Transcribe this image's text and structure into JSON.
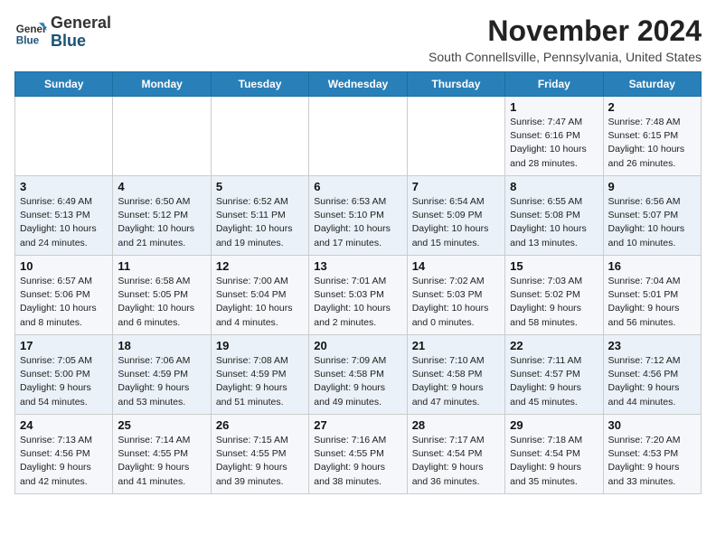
{
  "logo": {
    "general": "General",
    "blue": "Blue"
  },
  "header": {
    "month": "November 2024",
    "location": "South Connellsville, Pennsylvania, United States"
  },
  "weekdays": [
    "Sunday",
    "Monday",
    "Tuesday",
    "Wednesday",
    "Thursday",
    "Friday",
    "Saturday"
  ],
  "weeks": [
    [
      {
        "day": "",
        "info": ""
      },
      {
        "day": "",
        "info": ""
      },
      {
        "day": "",
        "info": ""
      },
      {
        "day": "",
        "info": ""
      },
      {
        "day": "",
        "info": ""
      },
      {
        "day": "1",
        "info": "Sunrise: 7:47 AM\nSunset: 6:16 PM\nDaylight: 10 hours and 28 minutes."
      },
      {
        "day": "2",
        "info": "Sunrise: 7:48 AM\nSunset: 6:15 PM\nDaylight: 10 hours and 26 minutes."
      }
    ],
    [
      {
        "day": "3",
        "info": "Sunrise: 6:49 AM\nSunset: 5:13 PM\nDaylight: 10 hours and 24 minutes."
      },
      {
        "day": "4",
        "info": "Sunrise: 6:50 AM\nSunset: 5:12 PM\nDaylight: 10 hours and 21 minutes."
      },
      {
        "day": "5",
        "info": "Sunrise: 6:52 AM\nSunset: 5:11 PM\nDaylight: 10 hours and 19 minutes."
      },
      {
        "day": "6",
        "info": "Sunrise: 6:53 AM\nSunset: 5:10 PM\nDaylight: 10 hours and 17 minutes."
      },
      {
        "day": "7",
        "info": "Sunrise: 6:54 AM\nSunset: 5:09 PM\nDaylight: 10 hours and 15 minutes."
      },
      {
        "day": "8",
        "info": "Sunrise: 6:55 AM\nSunset: 5:08 PM\nDaylight: 10 hours and 13 minutes."
      },
      {
        "day": "9",
        "info": "Sunrise: 6:56 AM\nSunset: 5:07 PM\nDaylight: 10 hours and 10 minutes."
      }
    ],
    [
      {
        "day": "10",
        "info": "Sunrise: 6:57 AM\nSunset: 5:06 PM\nDaylight: 10 hours and 8 minutes."
      },
      {
        "day": "11",
        "info": "Sunrise: 6:58 AM\nSunset: 5:05 PM\nDaylight: 10 hours and 6 minutes."
      },
      {
        "day": "12",
        "info": "Sunrise: 7:00 AM\nSunset: 5:04 PM\nDaylight: 10 hours and 4 minutes."
      },
      {
        "day": "13",
        "info": "Sunrise: 7:01 AM\nSunset: 5:03 PM\nDaylight: 10 hours and 2 minutes."
      },
      {
        "day": "14",
        "info": "Sunrise: 7:02 AM\nSunset: 5:03 PM\nDaylight: 10 hours and 0 minutes."
      },
      {
        "day": "15",
        "info": "Sunrise: 7:03 AM\nSunset: 5:02 PM\nDaylight: 9 hours and 58 minutes."
      },
      {
        "day": "16",
        "info": "Sunrise: 7:04 AM\nSunset: 5:01 PM\nDaylight: 9 hours and 56 minutes."
      }
    ],
    [
      {
        "day": "17",
        "info": "Sunrise: 7:05 AM\nSunset: 5:00 PM\nDaylight: 9 hours and 54 minutes."
      },
      {
        "day": "18",
        "info": "Sunrise: 7:06 AM\nSunset: 4:59 PM\nDaylight: 9 hours and 53 minutes."
      },
      {
        "day": "19",
        "info": "Sunrise: 7:08 AM\nSunset: 4:59 PM\nDaylight: 9 hours and 51 minutes."
      },
      {
        "day": "20",
        "info": "Sunrise: 7:09 AM\nSunset: 4:58 PM\nDaylight: 9 hours and 49 minutes."
      },
      {
        "day": "21",
        "info": "Sunrise: 7:10 AM\nSunset: 4:58 PM\nDaylight: 9 hours and 47 minutes."
      },
      {
        "day": "22",
        "info": "Sunrise: 7:11 AM\nSunset: 4:57 PM\nDaylight: 9 hours and 45 minutes."
      },
      {
        "day": "23",
        "info": "Sunrise: 7:12 AM\nSunset: 4:56 PM\nDaylight: 9 hours and 44 minutes."
      }
    ],
    [
      {
        "day": "24",
        "info": "Sunrise: 7:13 AM\nSunset: 4:56 PM\nDaylight: 9 hours and 42 minutes."
      },
      {
        "day": "25",
        "info": "Sunrise: 7:14 AM\nSunset: 4:55 PM\nDaylight: 9 hours and 41 minutes."
      },
      {
        "day": "26",
        "info": "Sunrise: 7:15 AM\nSunset: 4:55 PM\nDaylight: 9 hours and 39 minutes."
      },
      {
        "day": "27",
        "info": "Sunrise: 7:16 AM\nSunset: 4:55 PM\nDaylight: 9 hours and 38 minutes."
      },
      {
        "day": "28",
        "info": "Sunrise: 7:17 AM\nSunset: 4:54 PM\nDaylight: 9 hours and 36 minutes."
      },
      {
        "day": "29",
        "info": "Sunrise: 7:18 AM\nSunset: 4:54 PM\nDaylight: 9 hours and 35 minutes."
      },
      {
        "day": "30",
        "info": "Sunrise: 7:20 AM\nSunset: 4:53 PM\nDaylight: 9 hours and 33 minutes."
      }
    ]
  ]
}
